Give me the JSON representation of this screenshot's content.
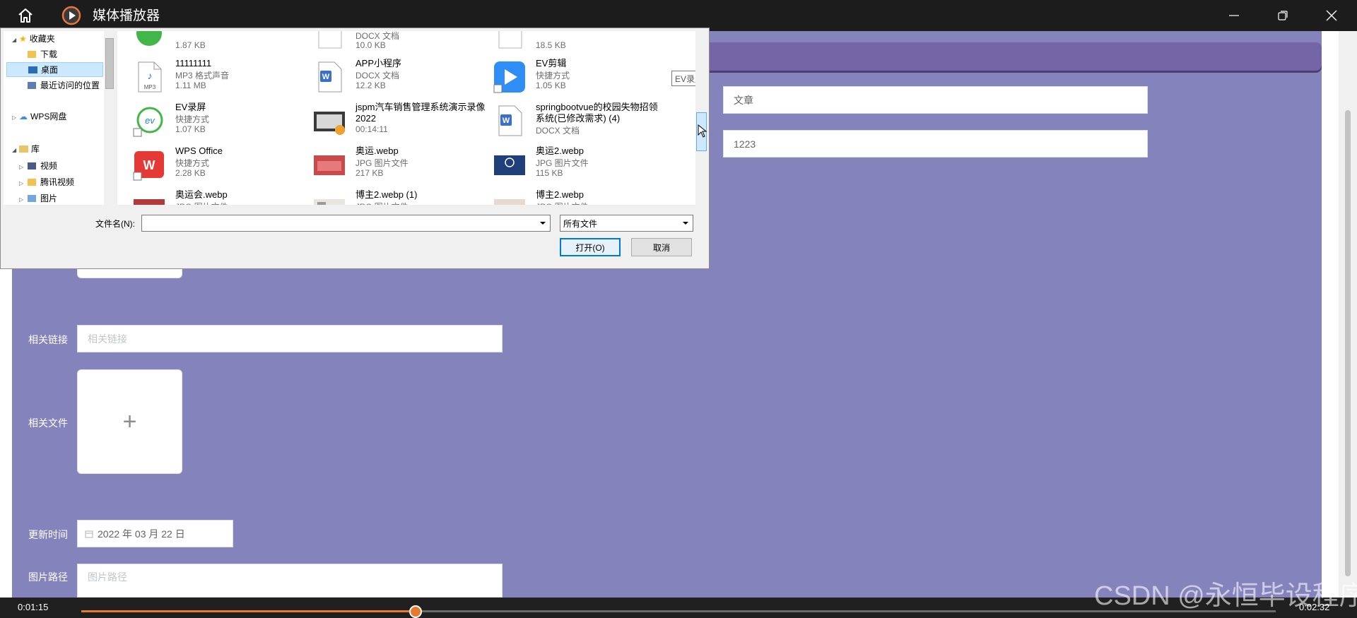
{
  "player": {
    "title": "媒体播放器",
    "elapsed": "0:01:15",
    "remaining": "0:02:32",
    "progress_fraction": 0.28
  },
  "form": {
    "right_fields": [
      {
        "value": "文章"
      },
      {
        "value": "1223"
      }
    ],
    "link_label": "相关链接",
    "link_placeholder": "相关链接",
    "file_label": "相关文件",
    "upload_plus": "+",
    "update_label": "更新时间",
    "update_value": "2022 年 03 月 22 日",
    "image_label": "图片路径",
    "image_placeholder": "图片路径"
  },
  "dialog": {
    "tree": [
      {
        "label": "收藏夹"
      },
      {
        "label": "下载"
      },
      {
        "label": "桌面"
      },
      {
        "label": "最近访问的位置"
      },
      {
        "label": "WPS网盘"
      },
      {
        "label": "库"
      },
      {
        "label": "视频"
      },
      {
        "label": "腾讯视频"
      },
      {
        "label": "图片"
      }
    ],
    "files": [
      {
        "name": "",
        "type": "",
        "size": "1.87 KB"
      },
      {
        "name": "",
        "type": "DOCX 文档",
        "size": "10.0 KB"
      },
      {
        "name": "",
        "type": "",
        "size": "18.5 KB"
      },
      {
        "name": "11111111",
        "type": "MP3 格式声音",
        "size": "1.11 MB"
      },
      {
        "name": "APP小程序",
        "type": "DOCX 文档",
        "size": "12.2 KB"
      },
      {
        "name": "EV剪辑",
        "type": "快捷方式",
        "size": "1.05 KB"
      },
      {
        "name": "EV录屏",
        "type": "快捷方式",
        "size": "1.07 KB"
      },
      {
        "name": "jspm汽车销售管理系统演示录像2022",
        "type": "",
        "size": "00:14:11"
      },
      {
        "name": "springbootvue的校园失物招领系统(已修改需求) (4)",
        "type": "DOCX 文档",
        "size": ""
      },
      {
        "name": "WPS Office",
        "type": "快捷方式",
        "size": "2.28 KB"
      },
      {
        "name": "奥运.webp",
        "type": "JPG 图片文件",
        "size": "217 KB"
      },
      {
        "name": "奥运2.webp",
        "type": "JPG 图片文件",
        "size": "115 KB"
      },
      {
        "name": "奥运会.webp",
        "type": "JPG 图片文件",
        "size": ""
      },
      {
        "name": "博主2.webp (1)",
        "type": "JPG 图片文件",
        "size": ""
      },
      {
        "name": "博主2.webp",
        "type": "JPG 图片文件",
        "size": ""
      }
    ],
    "tooltip": "EV录屏",
    "filename_label": "文件名(N):",
    "filename_value": "",
    "filetype_value": "所有文件",
    "open_button": "打开(O)",
    "cancel_button": "取消"
  },
  "watermark": "CSDN @永恒毕设程序"
}
